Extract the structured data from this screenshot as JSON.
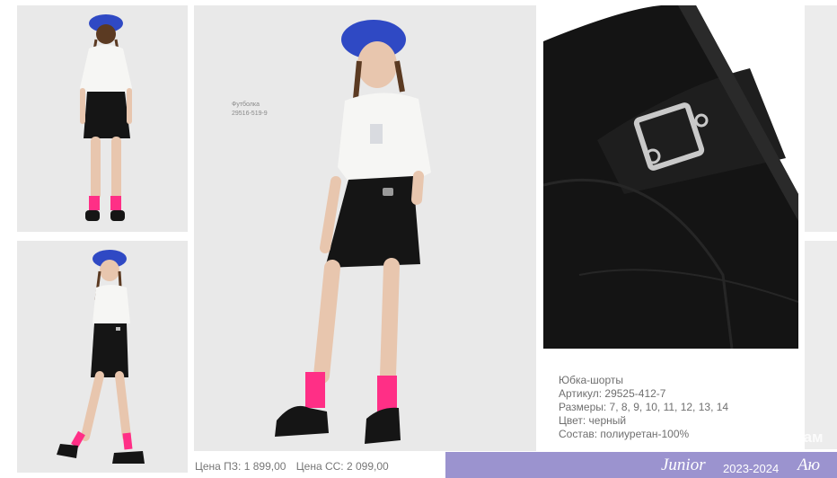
{
  "photos": {
    "tshirt_tag": {
      "title": "Футболка",
      "sku": "29516-519-9"
    }
  },
  "product": {
    "name": "Юбка-шорты",
    "article": "Артикул: 29525-412-7",
    "sizes": "Размеры: 7, 8, 9, 10, 11, 12, 13, 14",
    "color": "Цвет: черный",
    "composition": "Состав: полиуретан-100%"
  },
  "prices": {
    "partner": "Цена ПЗ: 1 899,00",
    "retail": "Цена СС: 2 099,00"
  },
  "footer": {
    "brand": "Junior",
    "season": "2023-2024",
    "logo": "Аю",
    "watermark": "для мам"
  },
  "colors": {
    "beret": "#2f49c4",
    "socks": "#ff2f86",
    "leather": "#151515",
    "footer_band": "#9b93cf"
  }
}
